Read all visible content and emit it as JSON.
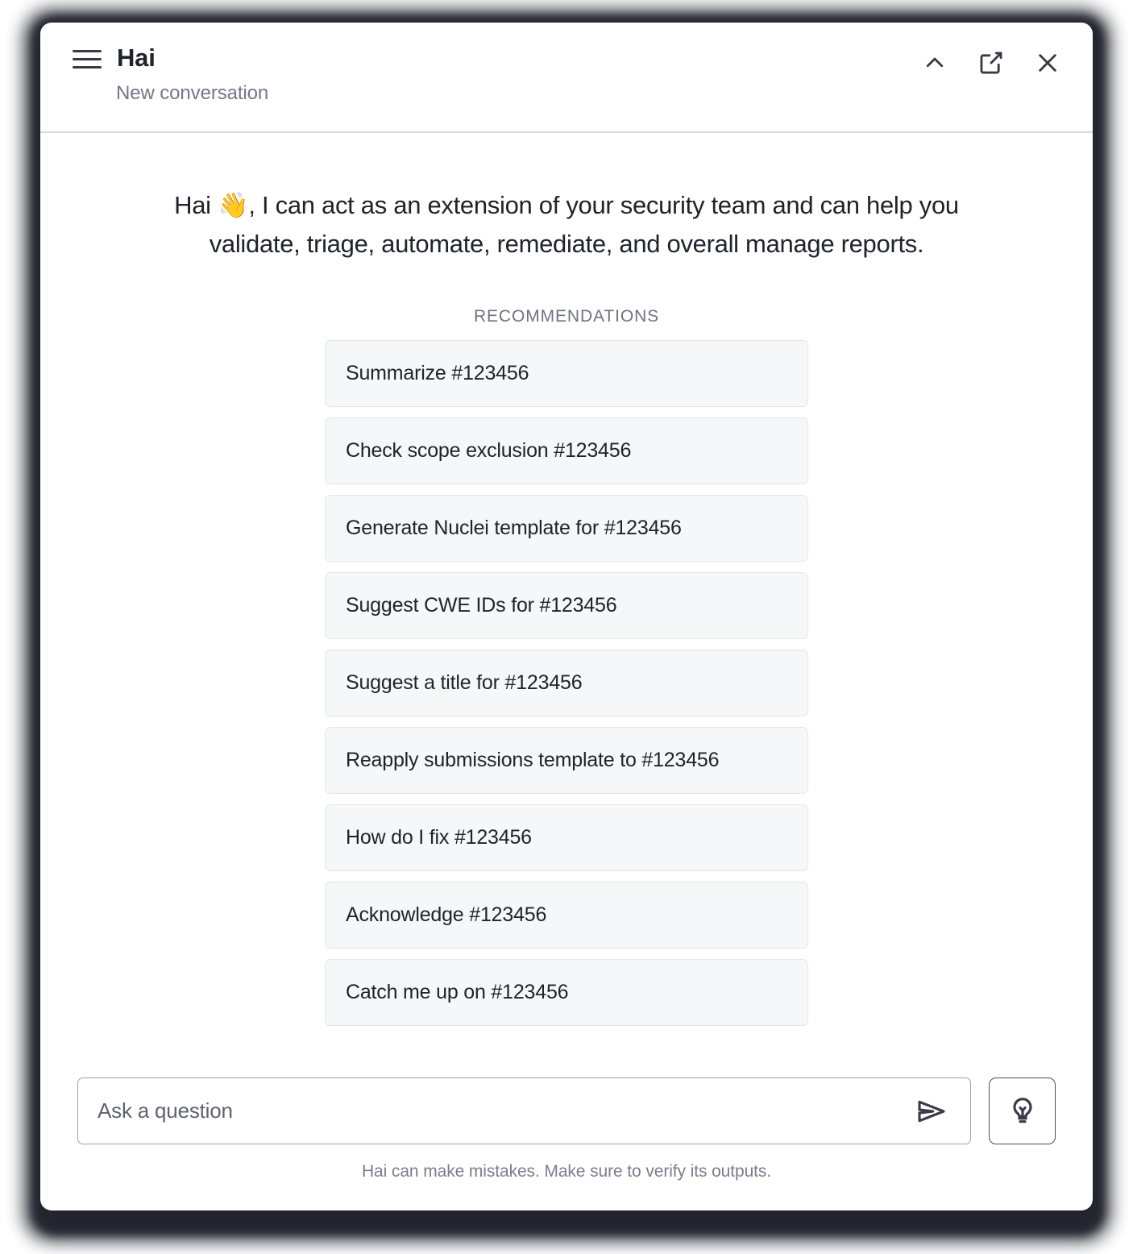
{
  "window": {
    "title": "Hai",
    "subtitle": "New conversation",
    "menu_icon": "hamburger-menu-icon",
    "collapse_icon": "chevron-up-icon",
    "popout_icon": "open-in-new-icon",
    "close_icon": "close-icon"
  },
  "main": {
    "greeting": "Hai 👋, I can act as an extension of your security team and can help you validate, triage, automate, remediate, and overall manage reports.",
    "recommendations_label": "RECOMMENDATIONS",
    "recommendations": [
      {
        "label": "Summarize #123456"
      },
      {
        "label": "Check scope exclusion #123456"
      },
      {
        "label": "Generate Nuclei template for #123456"
      },
      {
        "label": "Suggest CWE IDs for #123456"
      },
      {
        "label": "Suggest a title for #123456"
      },
      {
        "label": "Reapply submissions template to #123456"
      },
      {
        "label": "How do I fix #123456"
      },
      {
        "label": "Acknowledge #123456"
      },
      {
        "label": "Catch me up on #123456"
      }
    ]
  },
  "composer": {
    "placeholder": "Ask a question",
    "value": "",
    "send_icon": "send-arrow-icon",
    "suggestions_icon": "lightbulb-icon"
  },
  "footer": {
    "disclaimer": "Hai can make mistakes. Make sure to verify its outputs."
  },
  "colors": {
    "text_primary": "#21232c",
    "text_muted": "#737787",
    "card_background": "#ffffff",
    "recommendation_background": "#f6f7f9",
    "recommendation_border": "#e3e5ea",
    "divider": "#d9dbe0"
  }
}
